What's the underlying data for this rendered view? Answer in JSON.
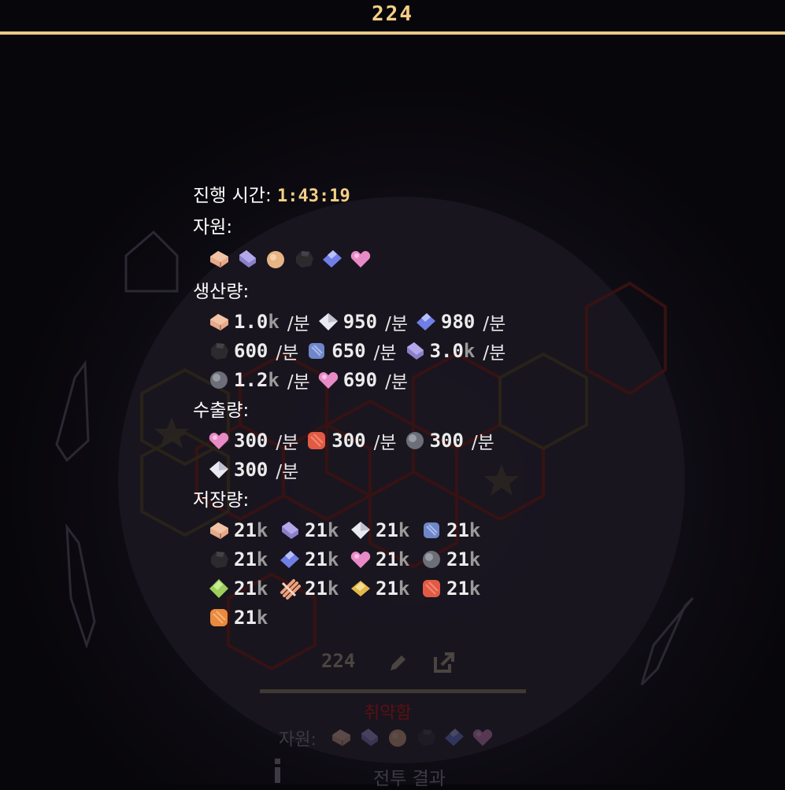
{
  "top_counter": "224",
  "stats": {
    "elapsed_label": "진행 시간:",
    "elapsed_value": "1:43:19",
    "resources_label": "자원:",
    "resources": [
      "copper-bar-icon",
      "purple-ingot-icon",
      "orange-orb-icon",
      "coal-icon",
      "blue-crystal-icon",
      "pink-heart-icon"
    ],
    "production_label": "생산량:",
    "production": [
      {
        "icon": "copper-bar-icon",
        "value": "1.0k",
        "unit": "/분"
      },
      {
        "icon": "white-crystal-icon",
        "value": "950",
        "unit": "/분"
      },
      {
        "icon": "blue-crystal-icon",
        "value": "980",
        "unit": "/분"
      },
      {
        "icon": "coal-icon",
        "value": "600",
        "unit": "/분"
      },
      {
        "icon": "blue-ore-icon",
        "value": "650",
        "unit": "/분"
      },
      {
        "icon": "purple-ingot-icon",
        "value": "3.0k",
        "unit": "/분"
      },
      {
        "icon": "gray-orb-icon",
        "value": "1.2k",
        "unit": "/분"
      },
      {
        "icon": "pink-heart-icon",
        "value": "690",
        "unit": "/분"
      }
    ],
    "export_label": "수출량:",
    "export": [
      {
        "icon": "pink-heart-icon",
        "value": "300",
        "unit": "/분"
      },
      {
        "icon": "red-ore-icon",
        "value": "300",
        "unit": "/분"
      },
      {
        "icon": "gray-orb-icon",
        "value": "300",
        "unit": "/분"
      },
      {
        "icon": "white-crystal-icon",
        "value": "300",
        "unit": "/분"
      }
    ],
    "storage_label": "저장량:",
    "storage": [
      {
        "icon": "copper-bar-icon",
        "value": "21k"
      },
      {
        "icon": "purple-ingot-icon",
        "value": "21k"
      },
      {
        "icon": "white-crystal-icon",
        "value": "21k"
      },
      {
        "icon": "blue-ore-icon",
        "value": "21k"
      },
      {
        "icon": "coal-icon",
        "value": "21k"
      },
      {
        "icon": "blue-crystal-icon",
        "value": "21k"
      },
      {
        "icon": "pink-heart-icon",
        "value": "21k"
      },
      {
        "icon": "gray-orb-icon",
        "value": "21k"
      },
      {
        "icon": "green-gem-icon",
        "value": "21k"
      },
      {
        "icon": "peach-bundle-icon",
        "value": "21k"
      },
      {
        "icon": "yellow-gem-icon",
        "value": "21k"
      },
      {
        "icon": "red-ore-icon",
        "value": "21k"
      },
      {
        "icon": "orange-ore-icon",
        "value": "21k"
      }
    ]
  },
  "bottom_panel": {
    "number": "224",
    "status": "취약함",
    "resources_label": "자원:",
    "battle_results": "전투 결과"
  },
  "colors": {
    "accent": "#e8c98a",
    "time": "#f5cf86",
    "hex_outline": "#5a1f17"
  }
}
